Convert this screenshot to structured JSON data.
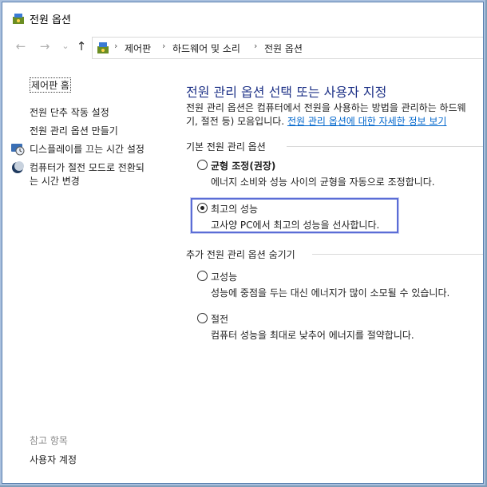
{
  "window": {
    "title": "전원 옵션"
  },
  "nav": {
    "back": "←",
    "forward": "→",
    "recent": "⌄",
    "up": "↑"
  },
  "address": {
    "crumbs": [
      "제어판",
      "하드웨어 및 소리",
      "전원 옵션"
    ],
    "separator": "›"
  },
  "left": {
    "home": "제어판 홈",
    "links": [
      "전원 단추 작동 설정",
      "전원 관리 옵션 만들기",
      "디스플레이를 끄는 시간 설정"
    ],
    "sleep_link_line1": "컴퓨터가 절전 모드로 전환되",
    "sleep_link_line2": "는 시간 변경",
    "see_also": "참고 항목",
    "user_accounts": "사용자 계정"
  },
  "main": {
    "title": "전원 관리 옵션 선택 또는 사용자 지정",
    "desc_line1": "전원 관리 옵션은 컴퓨터에서 전원을 사용하는 방법을 관리하는 하드웨",
    "desc_line2_prefix": "기, 절전 등) 모음입니다. ",
    "desc_link": "전원 관리 옵션에 대한 자세한 정보 보기",
    "basic_header": "기본 전원 관리 옵션",
    "extra_header": "추가 전원 관리 옵션 숨기기",
    "plans": [
      {
        "name": "균형 조정(권장)",
        "desc": "에너지 소비와 성능 사이의 균형을 자동으로 조정합니다.",
        "selected": false
      },
      {
        "name": "최고의 성능",
        "desc": "고사양 PC에서 최고의 성능을 선사합니다.",
        "selected": true
      },
      {
        "name": "고성능",
        "desc": "성능에 중점을 두는 대신 에너지가 많이 소모될 수 있습니다.",
        "selected": false
      },
      {
        "name": "절전",
        "desc": "컴퓨터 성능을 최대로 낮추어 에너지를 절약합니다.",
        "selected": false
      }
    ]
  },
  "colors": {
    "title_blue": "#1e3287",
    "link_blue": "#0066cc",
    "highlight_border": "#5b6dd6"
  }
}
